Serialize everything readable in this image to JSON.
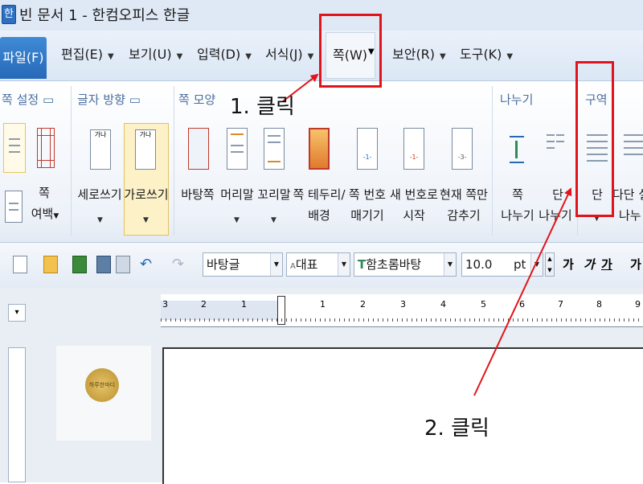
{
  "window": {
    "icon_label": "한",
    "title": "빈 문서 1 - 한컴오피스 한글"
  },
  "menubar": {
    "items": [
      {
        "id": "file",
        "label": "파일(F)"
      },
      {
        "id": "edit",
        "label": "편집(E)"
      },
      {
        "id": "view",
        "label": "보기(U)"
      },
      {
        "id": "input",
        "label": "입력(D)"
      },
      {
        "id": "format",
        "label": "서식(J)"
      },
      {
        "id": "page",
        "label": "쪽(W)"
      },
      {
        "id": "security",
        "label": "보안(R)"
      },
      {
        "id": "tools",
        "label": "도구(K)"
      }
    ]
  },
  "ribbon": {
    "groups": {
      "page_setup": "쪽 설정",
      "text_direction": "글자 방향",
      "page_shape": "쪽 모양",
      "divide": "나누기",
      "section": "구역"
    },
    "buttons": {
      "margin": [
        "쪽",
        "여백"
      ],
      "vertical": "세로쓰기",
      "horizontal": "가로쓰기",
      "background_page": "바탕쪽",
      "header": "머리말",
      "footer": "꼬리말",
      "border_bg": [
        "쪽 테두리/",
        "배경"
      ],
      "hide_page_num": [
        "쪽 번호",
        "매기기"
      ],
      "new_page_num": [
        "새 번호로",
        "시작"
      ],
      "hide_current": [
        "현재 쪽만",
        "감추기"
      ],
      "page_break": [
        "쪽",
        "나누기"
      ],
      "col_break": [
        "단",
        "나누기"
      ],
      "column": "단",
      "multi_column": [
        "다단 설",
        "나누"
      ]
    },
    "icon_text": {
      "vertical": "가나",
      "horizontal": "가나",
      "pn": "-1-",
      "pn3": "-3-"
    }
  },
  "toolbar": {
    "style": "바탕글",
    "font_lang": "대표",
    "font_name": "함초롬바탕",
    "font_size": "10.0",
    "size_unit": "pt",
    "format_buttons": [
      "가",
      "가",
      "가",
      "가"
    ]
  },
  "ruler": {
    "ticks": [
      "3",
      "2",
      "1",
      "1",
      "2",
      "3",
      "4",
      "5",
      "6",
      "7",
      "8",
      "9"
    ]
  },
  "stamp": {
    "text": "하루한마디"
  },
  "annotations": {
    "step1": "1. 클릭",
    "step2": "2. 클릭"
  },
  "colors": {
    "highlight": "#e2141b",
    "accent": "#2669b8",
    "group_title": "#4a6fa0"
  }
}
